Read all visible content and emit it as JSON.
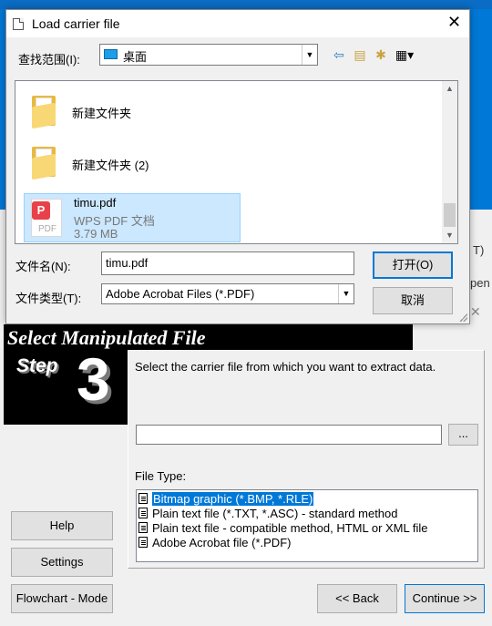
{
  "dialog": {
    "title": "Load carrier file",
    "close_glyph": "✕",
    "look_in_label": "查找范围(I):",
    "look_in_value": "桌面",
    "toolbar": {
      "back_icon": "back-arrow-icon",
      "up_icon": "up-folder-icon",
      "new_folder_icon": "new-folder-icon",
      "view_menu_icon": "view-menu-icon"
    },
    "files": [
      {
        "name": "新建文件夹",
        "kind": "folder"
      },
      {
        "name": "新建文件夹 (2)",
        "kind": "folder"
      },
      {
        "name": "timu.pdf",
        "kind": "pdf",
        "type": "WPS PDF 文档",
        "size": "3.79 MB",
        "selected": true
      }
    ],
    "pdf_icon_label": "PDF",
    "pdf_icon_badge": "P",
    "file_name_label": "文件名(N):",
    "file_name_value": "timu.pdf",
    "file_type_label": "文件类型(T):",
    "file_type_value": "Adobe Acrobat Files (*.PDF)",
    "open_button": "打开(O)",
    "cancel_button": "取消"
  },
  "background_app": {
    "edge_texts": [
      "T)",
      "pen"
    ],
    "banner_title": "Select Manipulated File",
    "step_label": "Step",
    "step_number": "3",
    "instruction": "Select the carrier file from which you want to extract data.",
    "path_value": "",
    "browse_button": "...",
    "file_type_label": "File Type:",
    "file_types": [
      {
        "label": "Bitmap graphic (*.BMP, *.RLE)",
        "selected": true
      },
      {
        "label": "Plain text file (*.TXT, *.ASC) - standard method",
        "selected": false
      },
      {
        "label": "Plain text file - compatible method, HTML or XML file",
        "selected": false
      },
      {
        "label": "Adobe Acrobat file (*.PDF)",
        "selected": false
      }
    ],
    "help_button": "Help",
    "settings_button": "Settings",
    "flowchart_button": "Flowchart - Mode",
    "back_button": "<< Back",
    "continue_button": "Continue >>"
  },
  "colors": {
    "desktop": "#0078d7",
    "selection": "#0078d7",
    "selected_file_bg": "#cce8ff"
  }
}
